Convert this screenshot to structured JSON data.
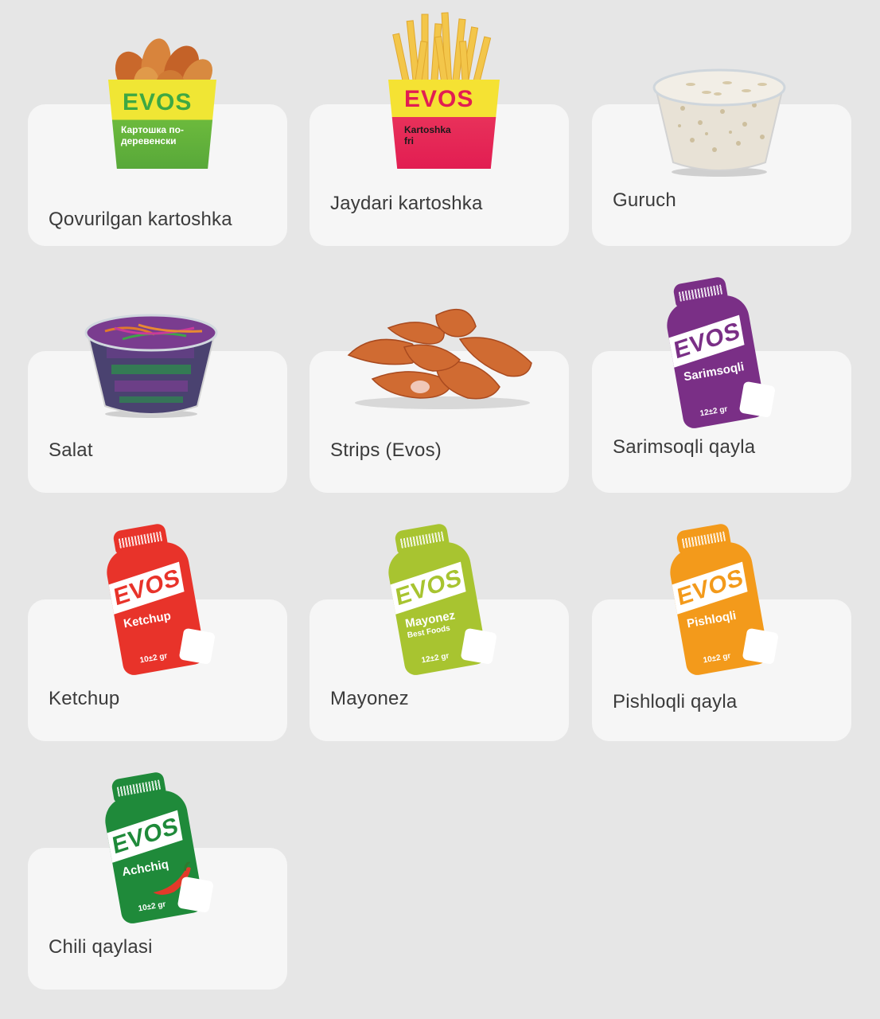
{
  "items": [
    {
      "label": "Qovurilgan kartoshka",
      "image": "potato-wedges-box"
    },
    {
      "label": "Jaydari kartoshka",
      "image": "french-fries-box"
    },
    {
      "label": "Guruch",
      "image": "rice-bowl"
    },
    {
      "label": "Salat",
      "image": "salad-bowl"
    },
    {
      "label": "Strips (Evos)",
      "image": "chicken-strips"
    },
    {
      "label": "Sarimsoqli qayla",
      "image": "garlic-sauce-bottle"
    },
    {
      "label": "Ketchup",
      "image": "ketchup-bottle"
    },
    {
      "label": "Mayonez",
      "image": "mayonnaise-bottle"
    },
    {
      "label": "Pishloqli qayla",
      "image": "cheese-sauce-bottle"
    },
    {
      "label": "Chili qaylasi",
      "image": "chili-sauce-bottle"
    }
  ],
  "packaging": {
    "wedges": {
      "brand": "EVOS",
      "text": "Картошка по-деревенски"
    },
    "fries": {
      "brand": "EVOS",
      "text": "Kartoshka fri"
    },
    "garlic": {
      "brand": "EVOS",
      "text": "Sarimsoqli",
      "weight": "12±2 gr"
    },
    "ketchup": {
      "brand": "EVOS",
      "text": "Ketchup",
      "weight": "10±2 gr"
    },
    "mayo": {
      "brand": "EVOS",
      "text": "Mayonez",
      "extra": "Best Foods",
      "weight": "12±2 gr"
    },
    "cheese": {
      "brand": "EVOS",
      "text": "Pishloqli",
      "weight": "10±2 gr"
    },
    "chili": {
      "brand": "EVOS",
      "text": "Achchiq",
      "weight": "10±2 gr"
    }
  },
  "colors": {
    "background": "#e6e6e6",
    "card": "#f6f6f6",
    "text": "#3b3b3b",
    "garlic": "#7a2f86",
    "ketchup": "#e8332a",
    "mayo": "#a8c430",
    "cheese": "#f39a1b",
    "chili": "#1f8a3a"
  }
}
